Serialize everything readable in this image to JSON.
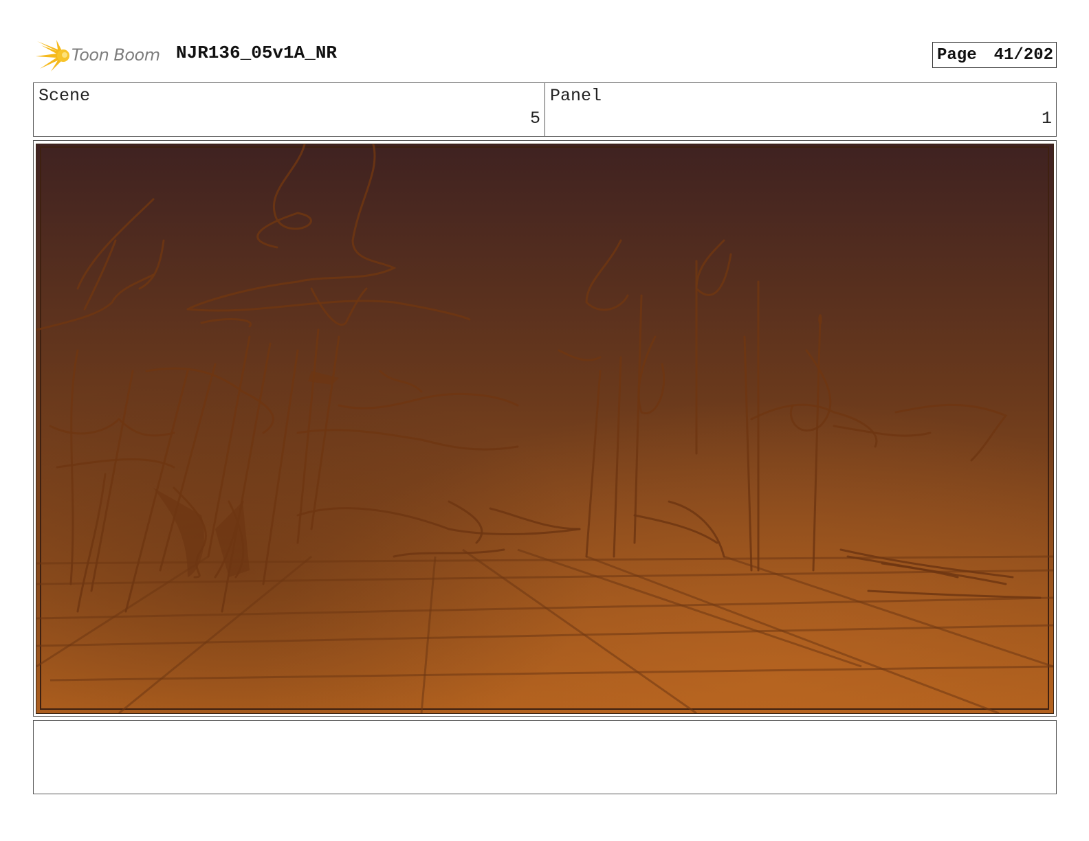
{
  "header": {
    "logo_text": "Toon Boom",
    "title": "NJR136_05v1A_NR",
    "page_label": "Page",
    "page_value": "41/202"
  },
  "info": {
    "scene_label": "Scene",
    "scene_value": "5",
    "panel_label": "Panel",
    "panel_value": "1"
  },
  "panel_image": {
    "icon": "sketch-artwork",
    "colors": {
      "top": "#3f2221",
      "middle": "#6b3a1c",
      "bottom": "#b0601e",
      "stroke": "#6e3612"
    }
  },
  "notes": {
    "text": ""
  }
}
